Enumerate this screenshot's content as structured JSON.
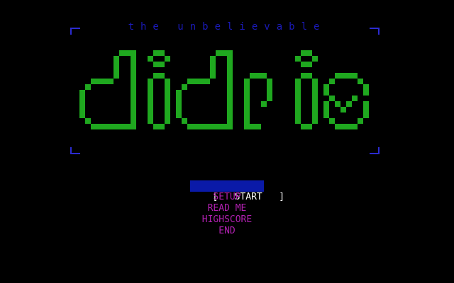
{
  "subtitle": "the unbelievable",
  "logo": {
    "text": "didris",
    "color": "#1fa81f"
  },
  "frame_color": "#2b2bd0",
  "menu": {
    "selected_index": 0,
    "items": [
      {
        "label": "START"
      },
      {
        "label": "SETUP"
      },
      {
        "label": "READ ME"
      },
      {
        "label": "HIGHSCORE"
      },
      {
        "label": "END"
      }
    ],
    "selector_left": "[",
    "selector_right": "]"
  },
  "colors": {
    "menu_text": "#b020b0",
    "selected_bg": "#0a1aa8",
    "selected_text": "#ffffff",
    "subtitle": "#1a1ab8"
  }
}
